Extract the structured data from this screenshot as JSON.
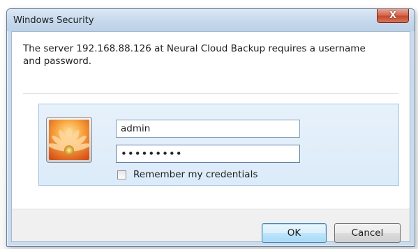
{
  "window": {
    "title": "Windows Security",
    "close_glyph": "X"
  },
  "message": {
    "text": "The server 192.168.88.126 at Neural Cloud Backup requires a username and password."
  },
  "credentials": {
    "user_tile_icon": "flower-user-tile",
    "username_value": "admin",
    "password_value": "•••••••••",
    "remember_label": "Remember my credentials",
    "remember_checked": false
  },
  "buttons": {
    "ok_label": "OK",
    "cancel_label": "Cancel"
  }
}
